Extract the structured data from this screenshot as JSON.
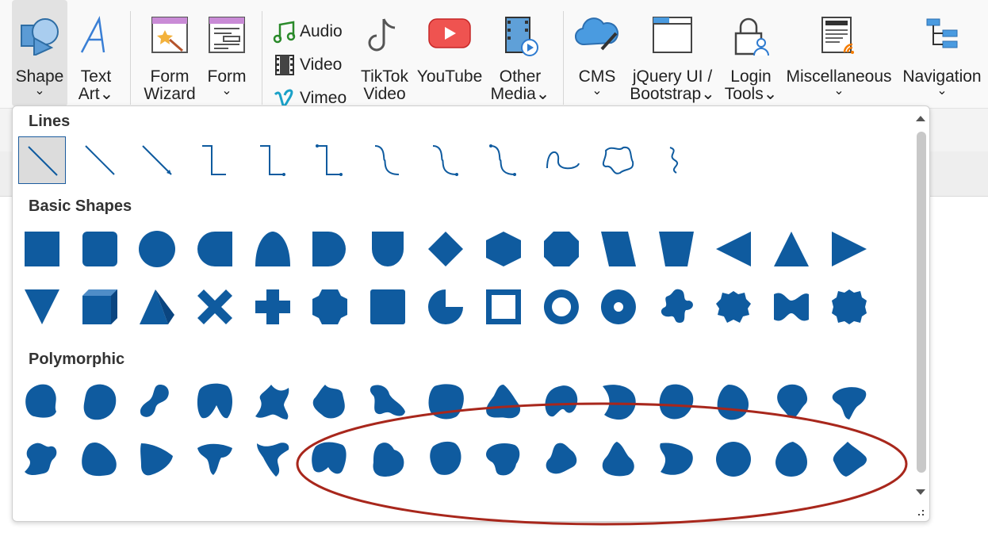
{
  "ribbon": {
    "buttons": [
      {
        "id": "shape",
        "label1": "Shape",
        "label2": "⌄"
      },
      {
        "id": "text-art",
        "label1": "Text",
        "label2": "Art⌄"
      },
      {
        "id": "form-wizard",
        "label1": "Form",
        "label2": "Wizard"
      },
      {
        "id": "form",
        "label1": "Form",
        "label2": "⌄"
      },
      {
        "id": "tiktok",
        "label1": "TikTok",
        "label2": "Video"
      },
      {
        "id": "youtube",
        "label1": "YouTube",
        "label2": ""
      },
      {
        "id": "other-media",
        "label1": "Other",
        "label2": "Media⌄"
      },
      {
        "id": "cms",
        "label1": "CMS",
        "label2": "⌄"
      },
      {
        "id": "jquery",
        "label1": "jQuery UI /",
        "label2": "Bootstrap⌄"
      },
      {
        "id": "login",
        "label1": "Login",
        "label2": "Tools⌄"
      },
      {
        "id": "misc",
        "label1": "Miscellaneous",
        "label2": "⌄"
      },
      {
        "id": "navigation",
        "label1": "Navigation",
        "label2": "⌄"
      }
    ],
    "media_small": [
      {
        "id": "audio",
        "label": "Audio",
        "icon": "music-note-icon"
      },
      {
        "id": "video",
        "label": "Video",
        "icon": "film-icon"
      },
      {
        "id": "vimeo",
        "label": "Vimeo",
        "icon": "vimeo-icon"
      }
    ]
  },
  "gallery": {
    "sections": [
      {
        "title": "Lines",
        "count": 12
      },
      {
        "title": "Basic Shapes",
        "count": 30
      },
      {
        "title": "Polymorphic",
        "count": 30
      }
    ],
    "accent_color": "#0f5b9f",
    "annotation_color": "#a8271c"
  }
}
